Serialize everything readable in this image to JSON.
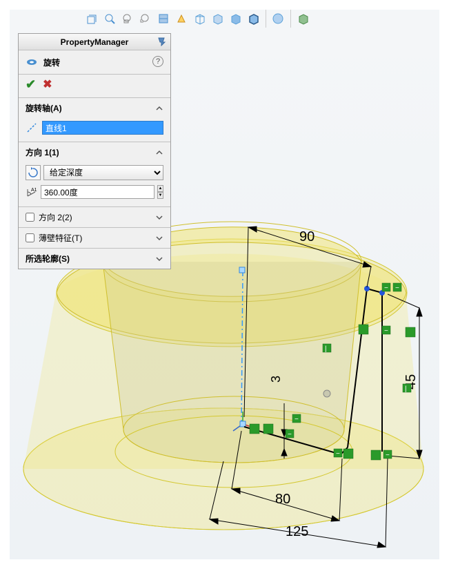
{
  "toolbar": {
    "icons": [
      "view-orientation",
      "zoom-fit",
      "zoom-area",
      "zoom-prev",
      "section-view",
      "display-style",
      "wireframe",
      "hidden-lines",
      "shaded",
      "shaded-edges",
      "separator",
      "view-scene",
      "separator",
      "render"
    ]
  },
  "panel": {
    "title": "PropertyManager",
    "feature_name": "旋转",
    "help": "?",
    "sections": {
      "axis": {
        "label": "旋转轴(A)",
        "value": "直线1"
      },
      "direction1": {
        "label": "方向 1(1)",
        "type_value": "给定深度",
        "angle_value": "360.00度"
      },
      "direction2": {
        "label": "方向 2(2)",
        "checked": false
      },
      "thin": {
        "label": "薄壁特征(T)",
        "checked": false
      },
      "contour": {
        "label": "所选轮廓(S)"
      }
    }
  },
  "dimensions": {
    "d90": "90",
    "d80": "80",
    "d125": "125",
    "d45": "45",
    "d3": "3"
  }
}
